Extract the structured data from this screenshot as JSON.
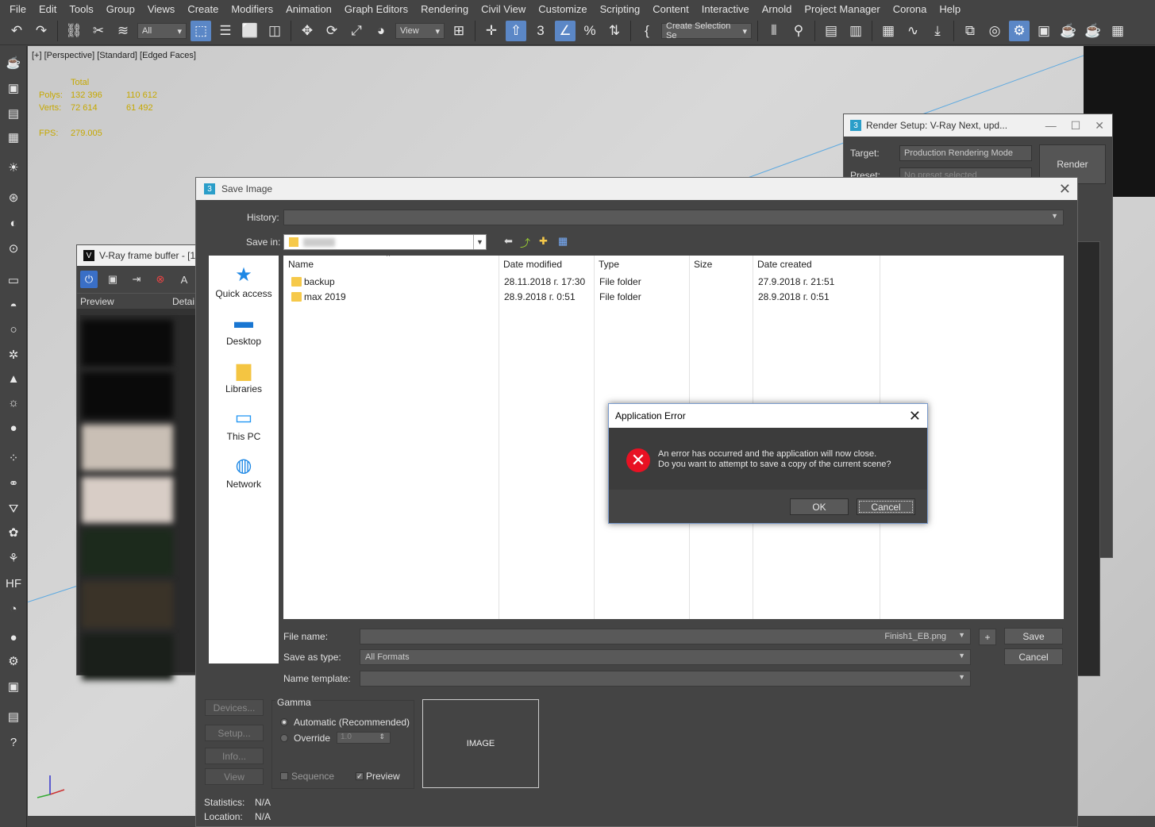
{
  "menubar": [
    "File",
    "Edit",
    "Tools",
    "Group",
    "Views",
    "Create",
    "Modifiers",
    "Animation",
    "Graph Editors",
    "Rendering",
    "Civil View",
    "Customize",
    "Scripting",
    "Content",
    "Interactive",
    "Arnold",
    "Project Manager",
    "Corona",
    "Help"
  ],
  "toolbar": {
    "filter_value": "All",
    "view_value": "View",
    "selection_set": "Create Selection Se"
  },
  "viewport": {
    "label": "[+] [Perspective] [Standard] [Edged Faces]",
    "stats_total": "Total",
    "polys_label": "Polys:",
    "polys_total": "132 396",
    "polys_sel": "110 612",
    "verts_label": "Verts:",
    "verts_total": "72 614",
    "verts_sel": "61 492",
    "fps_label": "FPS:",
    "fps_value": "279.005"
  },
  "render_setup": {
    "title": "Render Setup: V-Ray Next, upd...",
    "target_label": "Target:",
    "target_value": "Production Rendering Mode",
    "preset_label": "Preset:",
    "preset_value": "No preset selected",
    "render_button": "Render"
  },
  "vfb": {
    "title": "V-Ray frame buffer - [1",
    "preview_col": "Preview",
    "details_col": "Detai"
  },
  "save_dialog": {
    "title": "Save Image",
    "history_label": "History:",
    "save_in_label": "Save in:",
    "places": [
      "Quick access",
      "Desktop",
      "Libraries",
      "This PC",
      "Network"
    ],
    "columns": [
      "Name",
      "Date modified",
      "Type",
      "Size",
      "Date created"
    ],
    "files": [
      {
        "name": "backup",
        "modified": "28.11.2018 г. 17:30",
        "type": "File folder",
        "size": "",
        "created": "27.9.2018 г. 21:51"
      },
      {
        "name": "max 2019",
        "modified": "28.9.2018 г. 0:51",
        "type": "File folder",
        "size": "",
        "created": "28.9.2018 г. 0:51"
      }
    ],
    "file_name_label": "File name:",
    "file_name_value": "Finish1_EB.png",
    "save_as_type_label": "Save as type:",
    "save_as_type_value": "All Formats",
    "name_template_label": "Name template:",
    "plus_label": "+",
    "save_button": "Save",
    "cancel_button": "Cancel",
    "devices_button": "Devices...",
    "setup_button": "Setup...",
    "info_button": "Info...",
    "view_button": "View",
    "gamma_label": "Gamma",
    "gamma_auto": "Automatic (Recommended)",
    "gamma_override": "Override",
    "gamma_override_value": "1.0",
    "sequence_label": "Sequence",
    "preview_label": "Preview",
    "image_placeholder": "IMAGE",
    "statistics_label": "Statistics:",
    "statistics_value": "N/A",
    "location_label": "Location:",
    "location_value": "N/A"
  },
  "error_dialog": {
    "title": "Application Error",
    "line1": "An error has occurred and the application will now close.",
    "line2": "Do you want to attempt to save a copy of the current scene?",
    "ok_button": "OK",
    "cancel_button": "Cancel"
  },
  "colors": {
    "accent_blue": "#5b87c6",
    "error_red": "#e81123",
    "stats_yellow": "#c6a800"
  }
}
